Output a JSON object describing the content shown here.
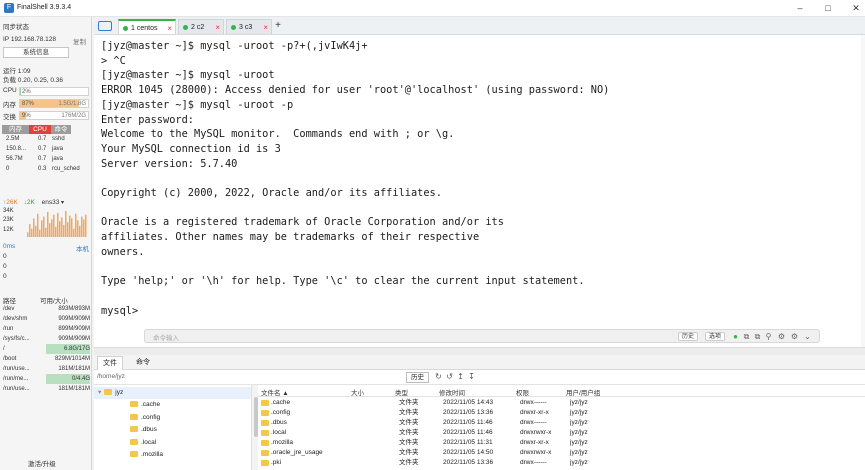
{
  "window": {
    "title": "FinalShell 3.9.3.4",
    "controls": [
      "minimize-icon",
      "maximize-icon",
      "close-icon"
    ]
  },
  "left": {
    "sync_status": "同步状态",
    "ip": "IP 192.168.78.128",
    "copy": "复制",
    "sysinfo_button": "系统信息",
    "uptime": "运行 1:09",
    "load": "负载 0.20, 0.25, 0.36",
    "cpu": {
      "label": "CPU",
      "value": "2%",
      "percent": 2
    },
    "mem": {
      "label": "内存",
      "value": "87%",
      "detail": "1.5G/1.8G",
      "percent": 87
    },
    "swap": {
      "label": "交换",
      "value": "9%",
      "detail": "176M/2G",
      "percent": 9
    },
    "proc_tabs": [
      "内存",
      "CPU",
      "命令"
    ],
    "processes": [
      {
        "mem": "2.5M",
        "cpu": "0.7",
        "cmd": "sshd"
      },
      {
        "mem": "150.8...",
        "cpu": "0.7",
        "cmd": "java"
      },
      {
        "mem": "56.7M",
        "cpu": "0.7",
        "cmd": "java"
      },
      {
        "mem": "0",
        "cpu": "0.3",
        "cmd": "rcu_sched"
      }
    ],
    "net": {
      "up": "↑26K",
      "down": "↓2K",
      "iface": "ens33"
    },
    "net_ticks": [
      "34K",
      "23K",
      "12K"
    ],
    "net_values": [
      5,
      14,
      9,
      20,
      12,
      25,
      8,
      18,
      22,
      10,
      27,
      15,
      19,
      24,
      11,
      26,
      17,
      21,
      13,
      28,
      16,
      23,
      20,
      9,
      25,
      18,
      12,
      22,
      19,
      24
    ],
    "latency": {
      "value": "0ms",
      "host": "本机",
      "ticks": [
        "0",
        "0",
        "0"
      ]
    },
    "disk_header": {
      "path": "路径",
      "avail": "可用/大小"
    },
    "disks": [
      {
        "path": "/dev",
        "size": "893M/893M"
      },
      {
        "path": "/dev/shm",
        "size": "909M/909M"
      },
      {
        "path": "/run",
        "size": "899M/909M"
      },
      {
        "path": "/sys/fs/c...",
        "size": "909M/909M"
      },
      {
        "path": "/",
        "size": "6.8G/17G"
      },
      {
        "path": "/boot",
        "size": "829M/1014M"
      },
      {
        "path": "/run/use...",
        "size": "181M/181M"
      },
      {
        "path": "/run/me...",
        "size": "0/4.4G"
      },
      {
        "path": "/run/use...",
        "size": "181M/181M"
      }
    ],
    "upgrade": "激活/升级"
  },
  "tabs": [
    {
      "label": "1 centos",
      "active": true
    },
    {
      "label": "2 c2",
      "active": false
    },
    {
      "label": "3 c3",
      "active": false
    }
  ],
  "terminal": {
    "lines": [
      "[jyz@master ~]$ mysql -uroot -p?+(,jvIwK4j+",
      "> ^C",
      "[jyz@master ~]$ mysql -uroot",
      "ERROR 1045 (28000): Access denied for user 'root'@'localhost' (using password: NO)",
      "[jyz@master ~]$ mysql -uroot -p",
      "Enter password:",
      "Welcome to the MySQL monitor.  Commands end with ; or \\g.",
      "Your MySQL connection id is 3",
      "Server version: 5.7.40",
      "",
      "Copyright (c) 2000, 2022, Oracle and/or its affiliates.",
      "",
      "Oracle is a registered trademark of Oracle Corporation and/or its",
      "affiliates. Other names may be trademarks of their respective",
      "owners.",
      "",
      "Type 'help;' or '\\h' for help. Type '\\c' to clear the current input statement.",
      "",
      "mysql>"
    ],
    "cmd_placeholder": "命令输入",
    "history_btn": "历史",
    "options_btn": "选项"
  },
  "bottom": {
    "tabs": [
      "文件",
      "命令"
    ],
    "path": "/home/jyz",
    "history_btn": "历史",
    "tree_root": "jyz",
    "tree": [
      ".cache",
      ".config",
      ".dbus",
      ".local",
      ".mozilla"
    ],
    "columns": [
      "文件名 ▲",
      "大小",
      "类型",
      "修改时间",
      "权限",
      "用户/用户组"
    ],
    "files": [
      {
        "name": ".cache",
        "size": "",
        "type": "文件夹",
        "time": "2022/11/05 14:43",
        "perm": "drwx------",
        "owner": "jyz/jyz"
      },
      {
        "name": ".config",
        "size": "",
        "type": "文件夹",
        "time": "2022/11/05 13:36",
        "perm": "drwxr-xr-x",
        "owner": "jyz/jyz"
      },
      {
        "name": ".dbus",
        "size": "",
        "type": "文件夹",
        "time": "2022/11/05 11:46",
        "perm": "drwx------",
        "owner": "jyz/jyz"
      },
      {
        "name": ".local",
        "size": "",
        "type": "文件夹",
        "time": "2022/11/05 11:46",
        "perm": "drwxrwxr-x",
        "owner": "jyz/jyz"
      },
      {
        "name": ".mozilla",
        "size": "",
        "type": "文件夹",
        "time": "2022/11/05 11:31",
        "perm": "drwxr-xr-x",
        "owner": "jyz/jyz"
      },
      {
        "name": ".oracle_jre_usage",
        "size": "",
        "type": "文件夹",
        "time": "2022/11/05 14:50",
        "perm": "drwxrwxr-x",
        "owner": "jyz/jyz"
      },
      {
        "name": ".pki",
        "size": "",
        "type": "文件夹",
        "time": "2022/11/05 13:36",
        "perm": "drwx------",
        "owner": "jyz/jyz"
      }
    ]
  }
}
